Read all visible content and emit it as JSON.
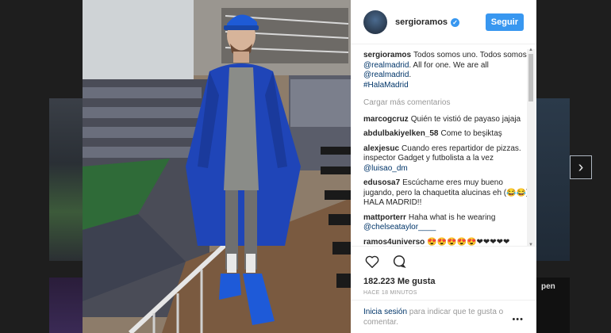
{
  "header": {
    "username": "sergioramos",
    "follow_label": "Seguir"
  },
  "caption": {
    "username": "sergioramos",
    "text_before": "Todos somos uno. Todos somos ",
    "mention_1": "@realmadrid",
    "text_middle": ". All for one. We are all ",
    "mention_2": "@realmadrid",
    "text_after": ".",
    "hashtag": "#HalaMadrid"
  },
  "load_more": "Cargar más comentarios",
  "comments": [
    {
      "username": "marcogcruz",
      "text": "Quién te vistió de payaso jajaja",
      "mention": ""
    },
    {
      "username": "abdulbakiyelken_58",
      "text": "Come to beşiktaş",
      "mention": ""
    },
    {
      "username": "alexjesuc",
      "text": "Cuando eres repartidor de pizzas. inspector Gadget y futbolista a la vez",
      "mention": "@luisao_dm"
    },
    {
      "username": "edusosa7",
      "text": "Escúchame eres muy bueno jugando, pero la chaquetita alucinas eh (😂😂) HALA MADRID!!",
      "mention": ""
    },
    {
      "username": "mattporterr",
      "text": "Haha what is he wearing",
      "mention": "@chelseataylor____"
    },
    {
      "username": "ramos4universo",
      "text": "😍😍😍😍😍❤❤❤❤❤",
      "mention": ""
    }
  ],
  "likes": "182.223 Me gusta",
  "time": "HACE 18 MINUTOS",
  "login": {
    "link": "Inicia sesión",
    "text": " para indicar que te gusta o comentar."
  },
  "more_options": "•••",
  "next_arrow": "›",
  "background": {
    "right_label": "pen"
  },
  "icons": {
    "like": "heart-icon",
    "comment": "comment-icon",
    "verified": "verified-icon",
    "next": "chevron-right-icon"
  },
  "colors": {
    "accent": "#3897f0",
    "link": "#003569",
    "muted": "#999999"
  }
}
